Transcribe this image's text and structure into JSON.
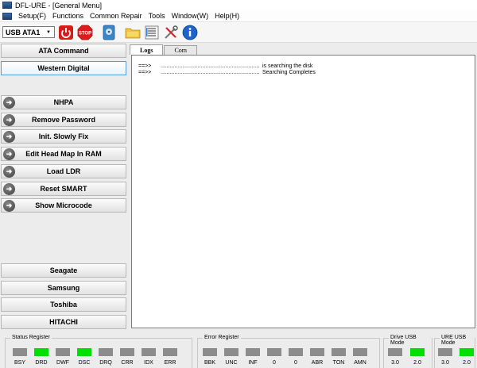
{
  "window": {
    "title": "DFL-URE - [General Menu]"
  },
  "menu": {
    "items": [
      {
        "label": "Setup(F)"
      },
      {
        "label": "Functions"
      },
      {
        "label": "Common Repair"
      },
      {
        "label": "Tools"
      },
      {
        "label": "Window(W)"
      },
      {
        "label": "Help(H)"
      }
    ]
  },
  "toolbar": {
    "port_value": "USB ATA1",
    "stop_label": "STOP",
    "colors": {
      "power": "#d81b1b",
      "stop": "#e01a1a",
      "info": "#1d63c9"
    }
  },
  "sidebar": {
    "top_buttons": [
      {
        "label": "ATA Command"
      },
      {
        "label": "Western Digital"
      }
    ],
    "function_buttons": [
      {
        "label": "NHPA"
      },
      {
        "label": "Remove Password"
      },
      {
        "label": "Init. Slowly Fix"
      },
      {
        "label": "Edit Head Map In RAM"
      },
      {
        "label": "Load LDR"
      },
      {
        "label": "Reset SMART"
      },
      {
        "label": "Show Microcode"
      }
    ],
    "vendor_buttons": [
      {
        "label": "Seagate"
      },
      {
        "label": "Samsung"
      },
      {
        "label": "Toshiba"
      },
      {
        "label": "HITACHI"
      }
    ]
  },
  "tabs": [
    {
      "label": "Logs"
    },
    {
      "label": "Com"
    }
  ],
  "log": {
    "lines": [
      {
        "prefix": "==>>",
        "dots": "................................................................",
        "text": "is searching the disk"
      },
      {
        "prefix": "==>>",
        "dots": "................................................................",
        "text": "Searching Completes"
      }
    ]
  },
  "status": {
    "status_register": {
      "title": "Status Register",
      "leds": [
        {
          "label": "BSY",
          "on": false
        },
        {
          "label": "DRD",
          "on": true
        },
        {
          "label": "DWF",
          "on": false
        },
        {
          "label": "DSC",
          "on": true
        },
        {
          "label": "DRQ",
          "on": false
        },
        {
          "label": "CRR",
          "on": false
        },
        {
          "label": "IDX",
          "on": false
        },
        {
          "label": "ERR",
          "on": false
        }
      ]
    },
    "error_register": {
      "title": "Error Register",
      "leds": [
        {
          "label": "BBK",
          "on": false
        },
        {
          "label": "UNC",
          "on": false
        },
        {
          "label": "INF",
          "on": false
        },
        {
          "label": "0",
          "on": false
        },
        {
          "label": "0",
          "on": false
        },
        {
          "label": "ABR",
          "on": false
        },
        {
          "label": "TON",
          "on": false
        },
        {
          "label": "AMN",
          "on": false
        }
      ]
    },
    "drive_usb_mode": {
      "title": "Drive USB Mode",
      "leds": [
        {
          "label": "3.0",
          "on": false
        },
        {
          "label": "2.0",
          "on": true
        }
      ]
    },
    "ure_usb_mode": {
      "title": "URE USB Mode",
      "leds": [
        {
          "label": "3.0",
          "on": false
        },
        {
          "label": "2.0",
          "on": true
        }
      ]
    }
  }
}
